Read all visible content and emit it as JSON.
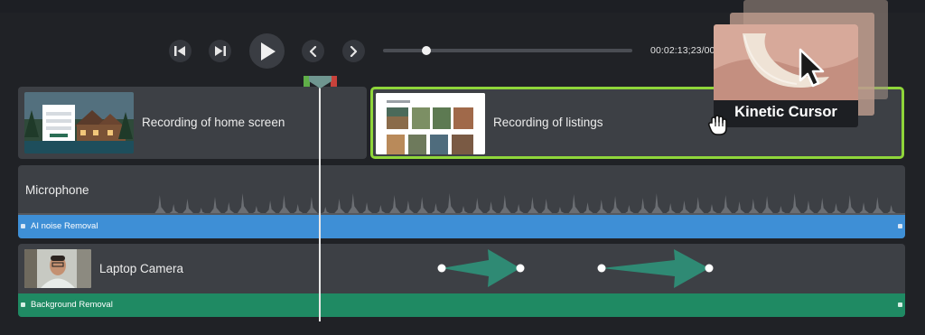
{
  "player": {
    "timecode": "00:02:13;23/00",
    "progress": 0.16,
    "controls": [
      "step-back-icon",
      "step-forward-icon",
      "play-icon",
      "previous-icon",
      "next-icon"
    ]
  },
  "tracks": {
    "video": {
      "clip1_label": "Recording of home screen",
      "clip2_label": "Recording of listings"
    },
    "audio": {
      "label": "Microphone",
      "effect_label": "AI noise Removal"
    },
    "camera": {
      "label": "Laptop Camera",
      "effect_label": "Background Removal"
    }
  },
  "overlay": {
    "title": "Kinetic Cursor"
  },
  "colors": {
    "selection_outline": "#8fd63a",
    "audio_effect": "#3e8fd6",
    "camera_effect": "#1f8a63",
    "animation_arrow": "#2f8a74"
  }
}
